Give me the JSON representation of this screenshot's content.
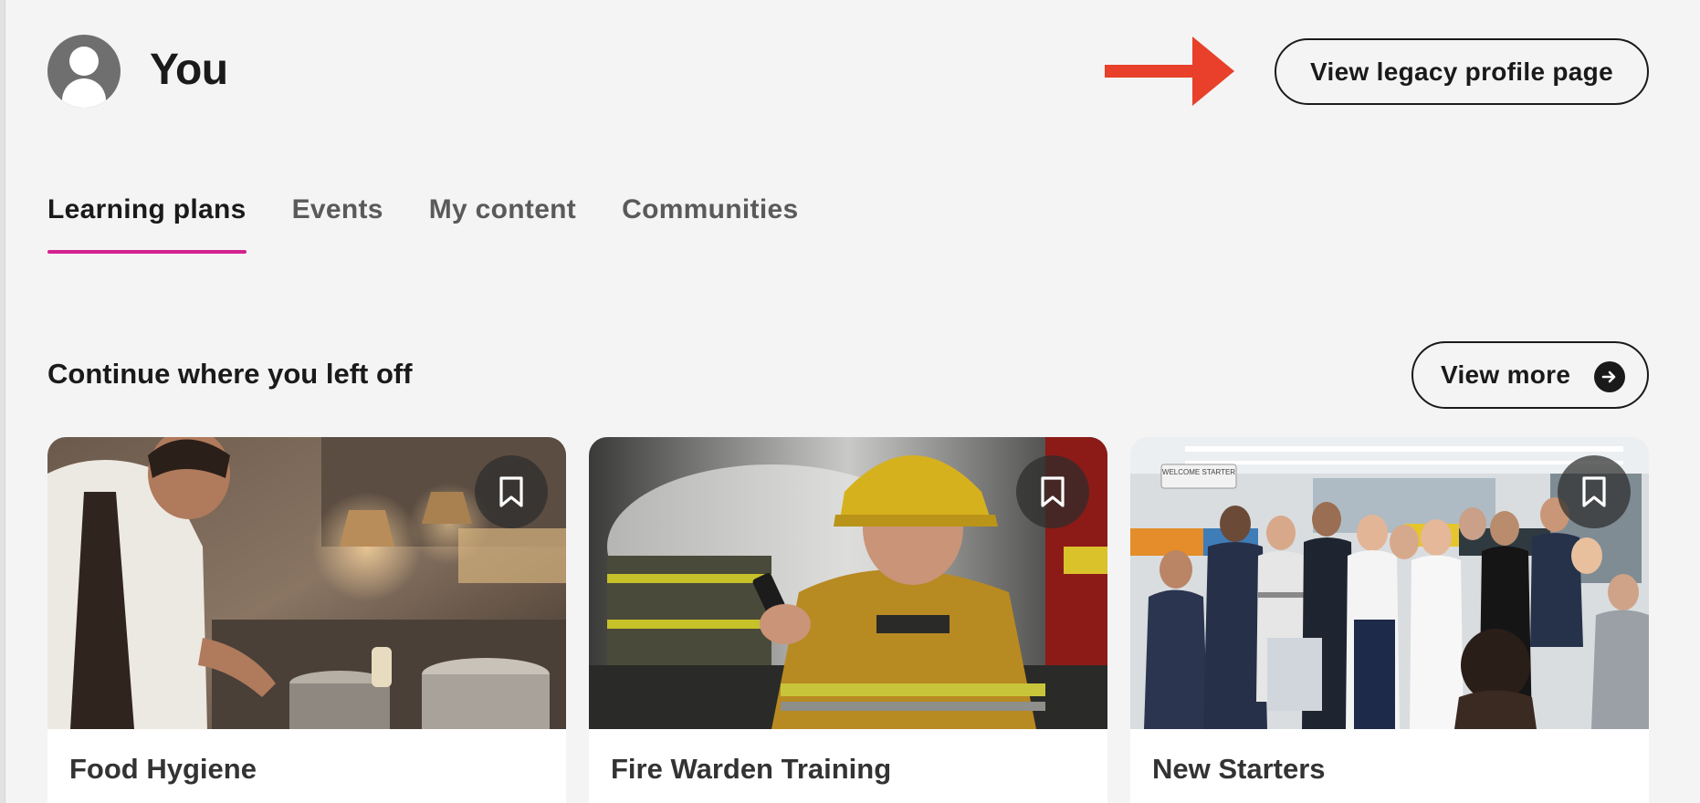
{
  "header": {
    "title": "You",
    "legacy_button_label": "View legacy profile page"
  },
  "tabs": [
    {
      "label": "Learning plans",
      "active": true
    },
    {
      "label": "Events",
      "active": false
    },
    {
      "label": "My content",
      "active": false
    },
    {
      "label": "Communities",
      "active": false
    }
  ],
  "section": {
    "title": "Continue where you left off",
    "view_more_label": "View more"
  },
  "cards": [
    {
      "title": "Food Hygiene",
      "image": "chef-cooking-in-kitchen"
    },
    {
      "title": "Fire Warden Training",
      "image": "firefighter-with-radio"
    },
    {
      "title": "New Starters",
      "image": "office-welcome-group",
      "sign_text": "WELCOME STARTER"
    }
  ],
  "colors": {
    "tab_underline": "#d4218f",
    "annotation_arrow": "#e8402a",
    "background": "#f4f4f4"
  }
}
